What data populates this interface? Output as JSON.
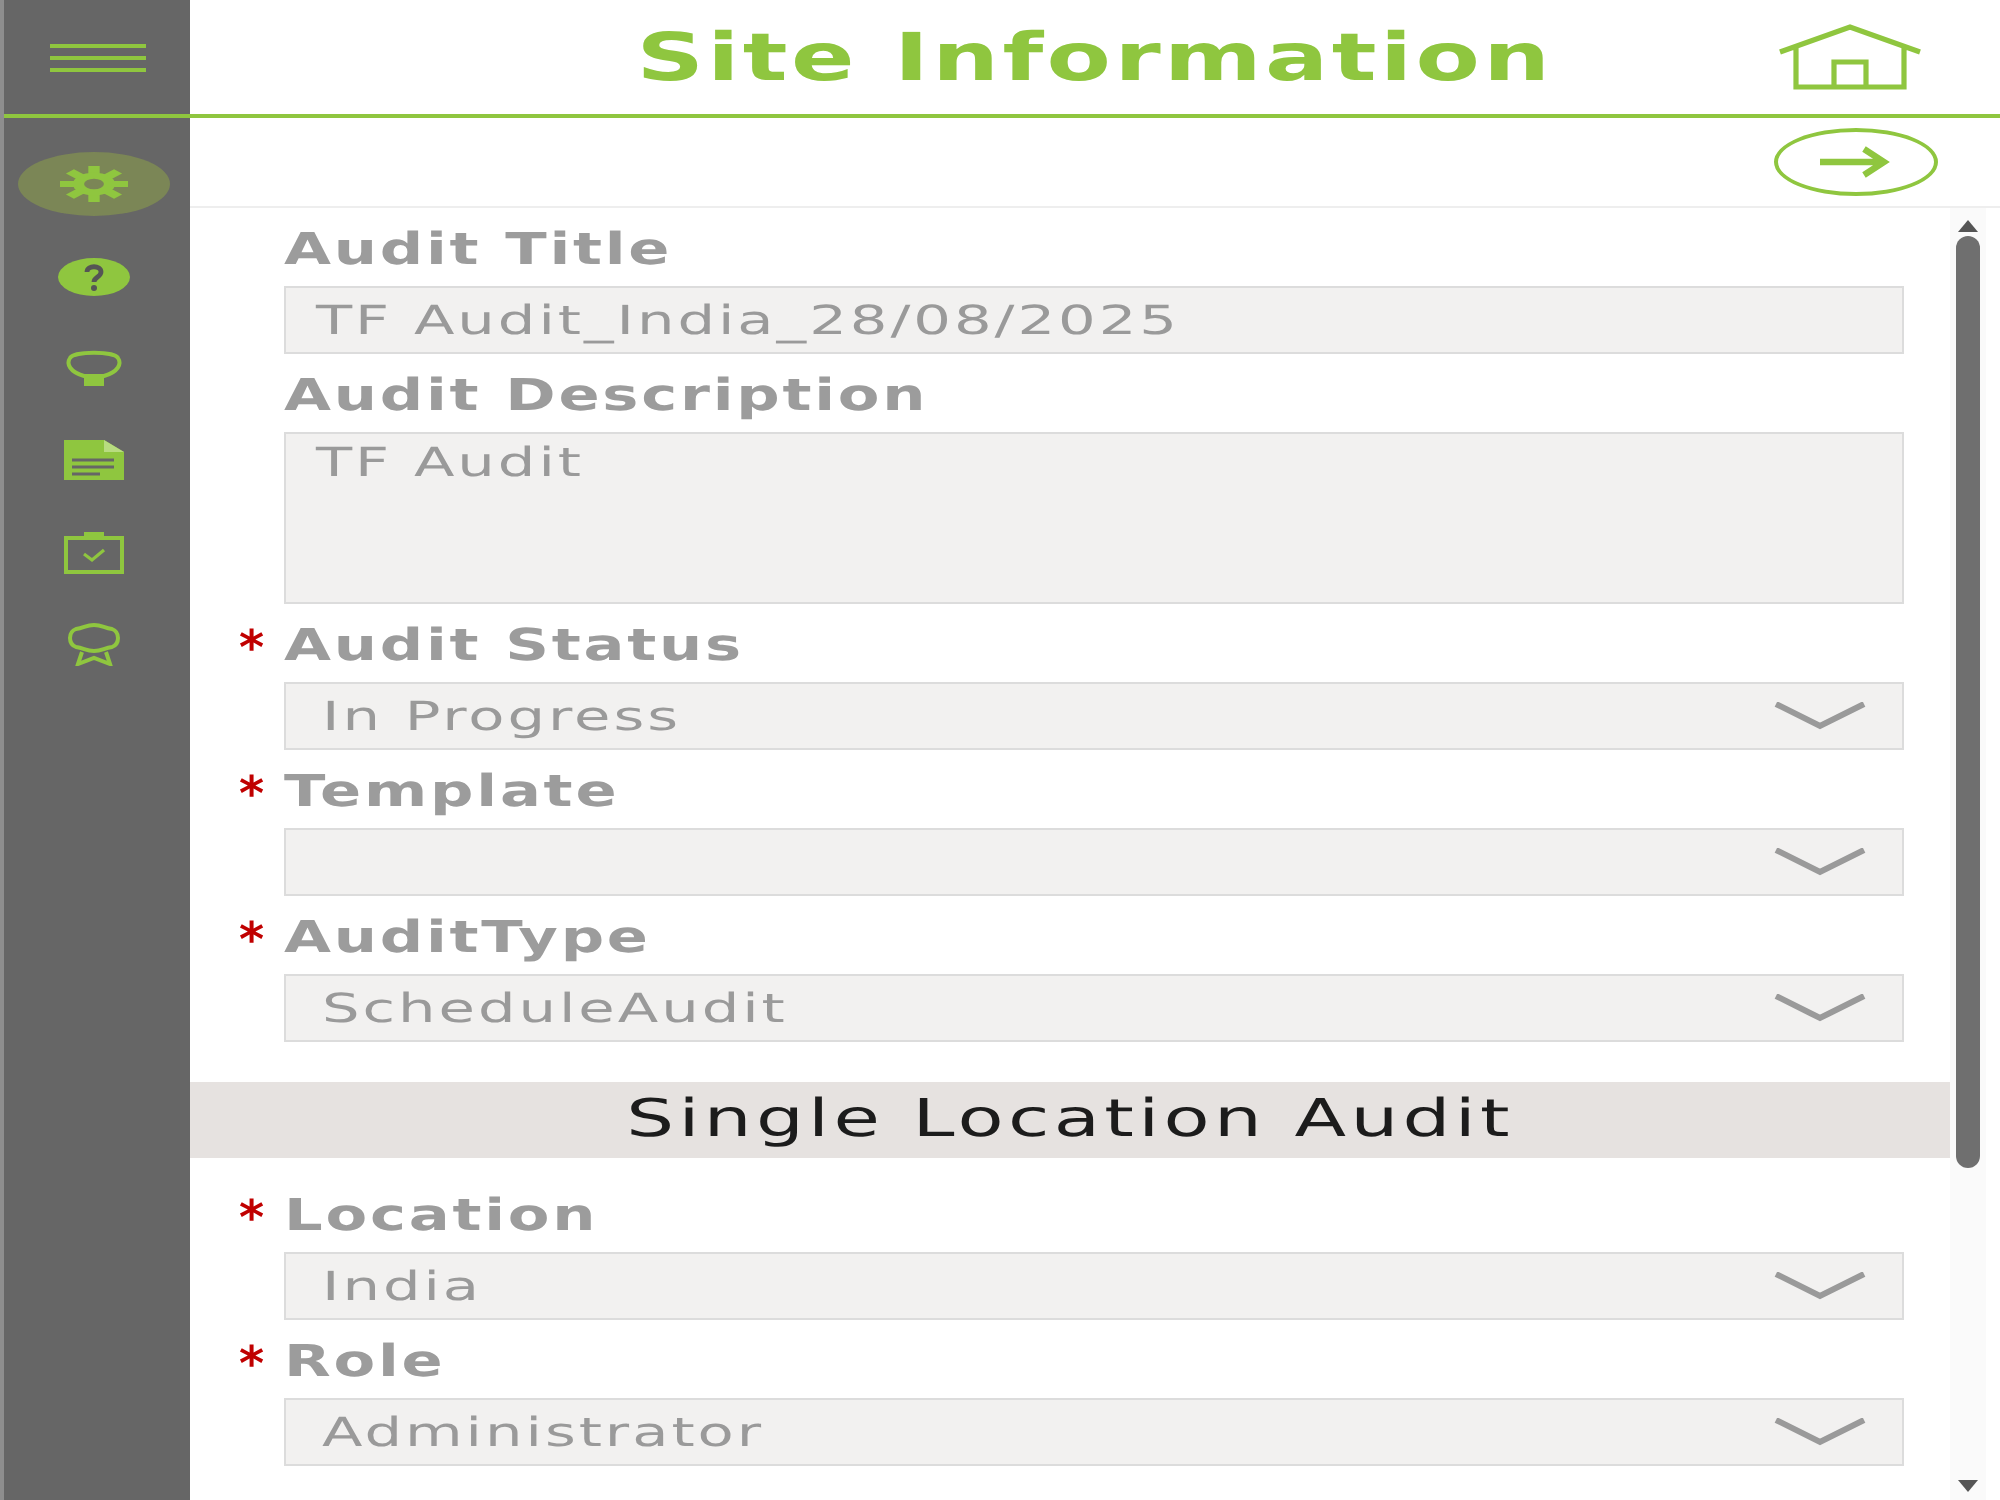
{
  "sidebar": {
    "items": [
      {
        "kind": "settings",
        "selected": true
      },
      {
        "kind": "help",
        "selected": false
      },
      {
        "kind": "idea",
        "selected": false
      },
      {
        "kind": "document",
        "selected": false
      },
      {
        "kind": "checklist",
        "selected": false
      },
      {
        "kind": "award",
        "selected": false
      }
    ]
  },
  "header": {
    "title": "Site Information"
  },
  "required_mark": "*",
  "form": {
    "fields": [
      {
        "kind": "text",
        "label": "Audit Title",
        "required": false,
        "value": "TF Audit_India_28/08/2025"
      },
      {
        "kind": "textarea",
        "label": "Audit Description",
        "required": false,
        "value": "TF Audit"
      },
      {
        "kind": "select",
        "label": "Audit Status",
        "required": true,
        "value": "In Progress"
      },
      {
        "kind": "select",
        "label": "Template",
        "required": true
      },
      {
        "kind": "select",
        "label": "AuditType",
        "required": true,
        "value": "ScheduleAudit"
      }
    ]
  },
  "section": {
    "title": "Single Location Audit",
    "fields": [
      {
        "kind": "select",
        "label": "Location",
        "required": true,
        "value": "India"
      },
      {
        "kind": "select",
        "label": "Role",
        "required": true,
        "value": "Administrator"
      }
    ]
  }
}
